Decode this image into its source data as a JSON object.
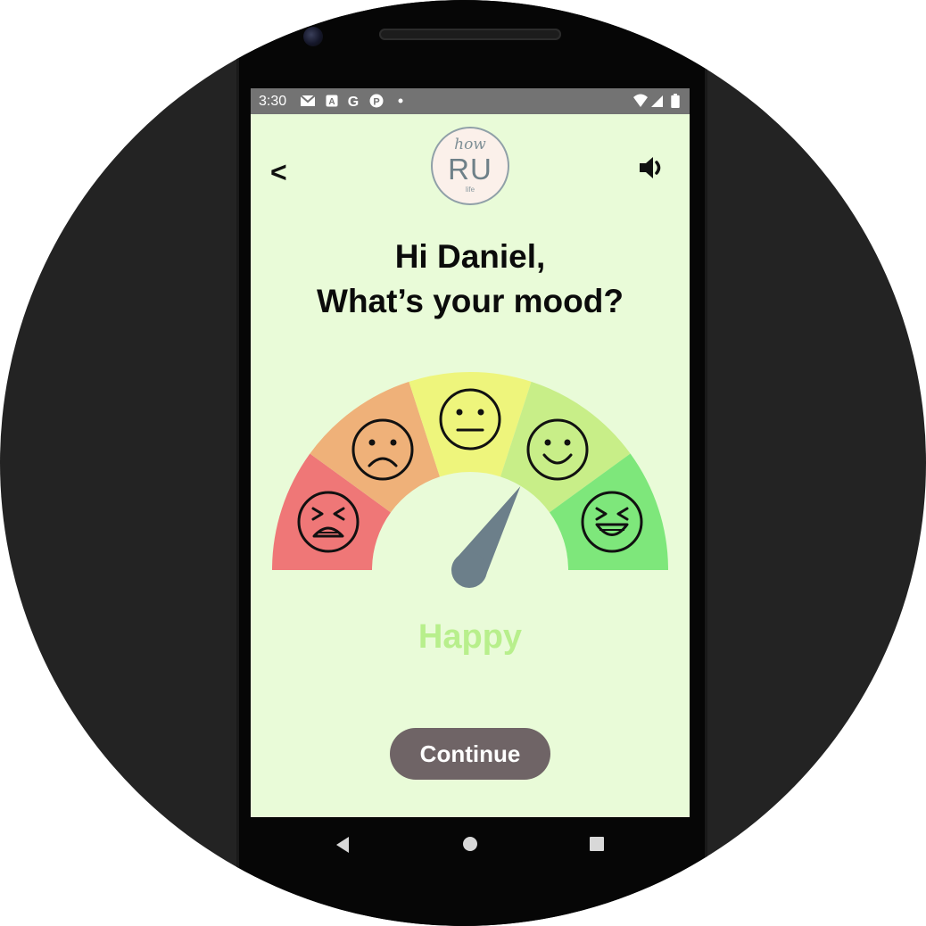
{
  "statusbar": {
    "time": "3:30",
    "icons": [
      "gmail-icon",
      "app-a-icon",
      "google-icon",
      "app-p-icon",
      "dot-icon",
      "wifi-icon",
      "signal-icon",
      "battery-icon"
    ]
  },
  "header": {
    "back_label": "<",
    "logo": {
      "top": "how",
      "main": "RU",
      "bottom": "life"
    },
    "volume_icon": "volume-icon"
  },
  "greeting": {
    "line1": "Hi Daniel,",
    "line2": "What’s your mood?"
  },
  "gauge": {
    "segments": [
      {
        "mood": "angry",
        "color": "#ef7777"
      },
      {
        "mood": "sad",
        "color": "#efb179"
      },
      {
        "mood": "neutral",
        "color": "#eef57c"
      },
      {
        "mood": "happy",
        "color": "#c8ee88"
      },
      {
        "mood": "very-happy",
        "color": "#7ee77b"
      }
    ],
    "selected_index": 3,
    "needle_color": "#6c7f8a"
  },
  "mood_label": "Happy",
  "continue_label": "Continue",
  "navbar": {
    "buttons": [
      "back-triangle-icon",
      "home-circle-icon",
      "recents-square-icon"
    ]
  }
}
